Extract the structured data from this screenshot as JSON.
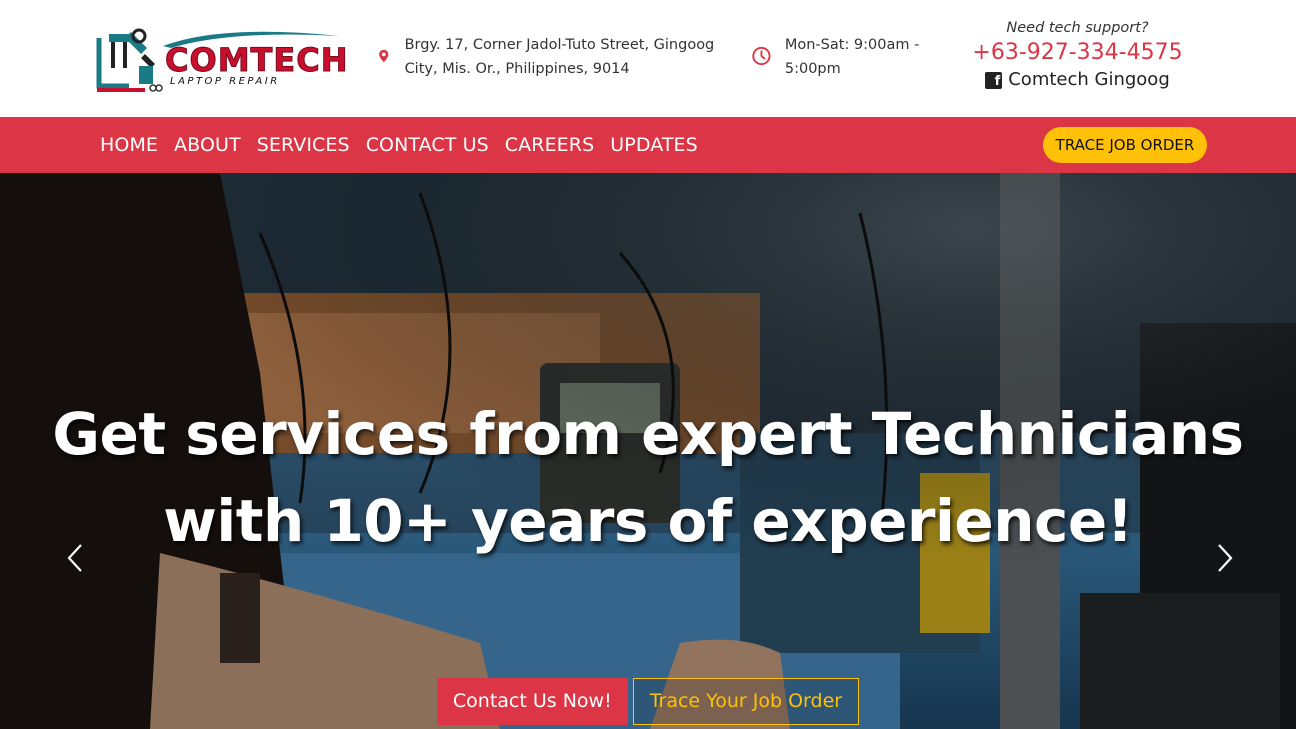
{
  "logo": {
    "name": "COMTECH",
    "tagline": "LAPTOP REPAIR"
  },
  "header": {
    "address": "Brgy. 17, Corner Jadol-Tuto Street, Gingoog City, Mis. Or., Philippines, 9014",
    "hours": "Mon-Sat: 9:00am - 5:00pm",
    "support_question": "Need tech support?",
    "phone": "+63-927-334-4575",
    "facebook": "Comtech Gingoog",
    "icons": [
      "map-marker-icon",
      "clock-icon",
      "facebook-icon"
    ]
  },
  "nav": {
    "items": [
      "HOME",
      "ABOUT",
      "SERVICES",
      "CONTACT US",
      "CAREERS",
      "UPDATES"
    ],
    "cta": "TRACE JOB ORDER"
  },
  "hero": {
    "title": "Get services from expert Technicians with 10+ years of experience!",
    "primary_button": "Contact Us Now!",
    "secondary_button": "Trace Your Job Order"
  },
  "colors": {
    "brand_red": "#dc3545",
    "accent_yellow": "#ffc107"
  }
}
